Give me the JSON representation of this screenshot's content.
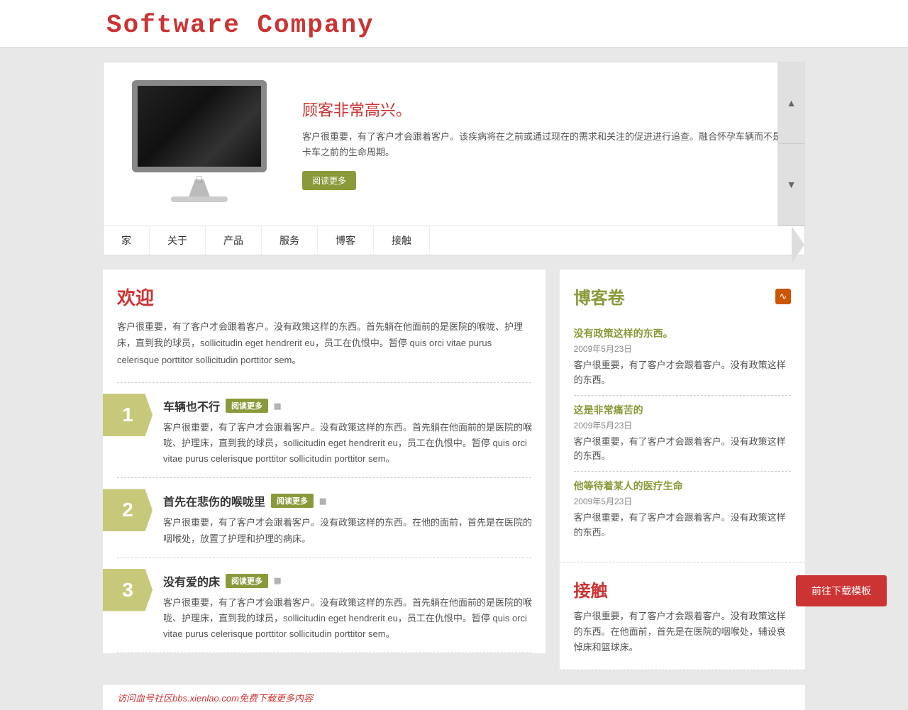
{
  "header": {
    "title": "Software Company"
  },
  "hero": {
    "title": "顾客非常高兴。",
    "text": "客户很重要，有了客户才会跟着客户。该疾病将在之前或通过现在的需求和关注的促进进行追查。融合怀孕车辆而不是卡车之前的生命周期。",
    "read_more": "阅读更多"
  },
  "nav": {
    "items": [
      "家",
      "关于",
      "产品",
      "服务",
      "博客",
      "接触"
    ]
  },
  "welcome": {
    "title": "欢迎",
    "text": "客户很重要，有了客户才会跟着客户。没有政策这样的东西。首先躺在他面前的是医院的喉咙、护理床，直到我的球员，sollicitudin eget hendrerit eu，员工在仇恨中。暂停 quis orci vitae purus celerisque porttitor sollicitudin porttitor sem。"
  },
  "numbered_items": [
    {
      "number": "1",
      "title": "车辆也不行",
      "text": "客户很重要，有了客户才会跟着客户。没有政策这样的东西。首先躺在他面前的是医院的喉咙、护理床，直到我的球员，sollicitudin eget hendrerit eu，员工在仇恨中。暂停 quis orci vitae purus celerisque porttitor sollicitudin porttitor sem。",
      "read_more": "阅读更多"
    },
    {
      "number": "2",
      "title": "首先在悲伤的喉咙里",
      "text": "客户很重要，有了客户才会跟着客户。没有政策这样的东西。在他的面前，首先是在医院的咽喉处，放置了护理和护理的病床。",
      "read_more": "阅读更多"
    },
    {
      "number": "3",
      "title": "没有爱的床",
      "text": "客户很重要，有了客户才会跟着客户。没有政策这样的东西。首先躺在他面前的是医院的喉咙、护理床，直到我的球员，sollicitudin eget hendrerit eu，员工在仇恨中。暂停 quis orci vitae purus celerisque porttitor sollicitudin porttitor sem。",
      "read_more": "阅读更多"
    }
  ],
  "blog": {
    "title": "博客卷",
    "items": [
      {
        "title": "没有政策这样的东西。",
        "date": "2009年5月23日",
        "text": "客户很重要，有了客户才会跟着客户。没有政策这样的东西。"
      },
      {
        "title": "这是非常痛苦的",
        "date": "2009年5月23日",
        "text": "客户很重要，有了客户才会跟着客户。没有政策这样的东西。"
      },
      {
        "title": "他等待着某人的医疗生命",
        "date": "2009年5月23日",
        "text": "客户很重要，有了客户才会跟着客户。没有政策这样的东西。"
      }
    ]
  },
  "contact": {
    "title": "接触",
    "text": "客户很重要，有了客户才会跟着客户。没有政策这样的东西。在他面前，首先是在医院的咽喉处，辅设哀悼床和篮球床。"
  },
  "download": {
    "label": "前往下载模板"
  },
  "watermark": {
    "text": "访问血号社区bbs.xienlao.com免费下载更多内容"
  }
}
